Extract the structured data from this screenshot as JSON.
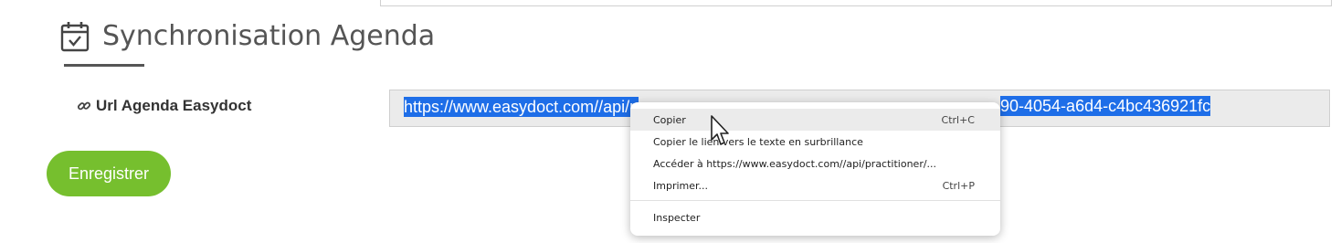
{
  "section": {
    "icon": "calendar-check-icon",
    "title": "Synchronisation Agenda"
  },
  "field": {
    "icon": "link-icon",
    "label": "Url Agenda Easydoct",
    "value_visible_start": "https://www.easydoct.com//api/p",
    "value_visible_end": "90-4054-a6d4-c4bc436921fc"
  },
  "save_button": {
    "label": "Enregistrer"
  },
  "context_menu": {
    "items": [
      {
        "label": "Copier",
        "shortcut": "Ctrl+C"
      },
      {
        "label": "Copier le lien vers le texte en surbrillance",
        "shortcut": ""
      },
      {
        "label": "Accéder à https://www.easydoct.com//api/practitioner/...",
        "shortcut": ""
      },
      {
        "label": "Imprimer...",
        "shortcut": "Ctrl+P"
      },
      {
        "label": "Inspecter",
        "shortcut": ""
      }
    ]
  },
  "colors": {
    "accent_green": "#76bf2e",
    "selection_blue": "#1e6ee8"
  }
}
